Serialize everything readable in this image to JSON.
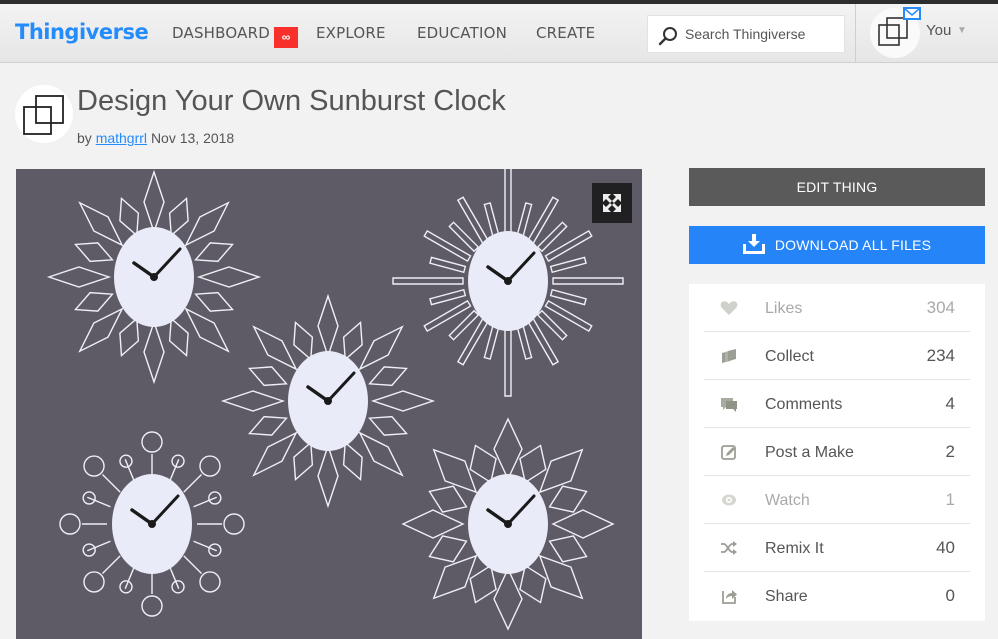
{
  "header": {
    "logo": "Thingiverse",
    "nav": [
      {
        "label": "DASHBOARD",
        "badge": "∞"
      },
      {
        "label": "EXPLORE"
      },
      {
        "label": "EDUCATION"
      },
      {
        "label": "CREATE"
      }
    ],
    "search": {
      "placeholder": "Search Thingiverse",
      "value": ""
    },
    "user": {
      "name": "You",
      "caret": "▼",
      "has_mail": true
    }
  },
  "thing": {
    "title": "Design Your Own Sunburst Clock",
    "by_prefix": "by",
    "author": "mathgrrl",
    "date": "Nov 13, 2018",
    "image_alt": "Five white sunburst wall clocks on a gray background"
  },
  "actions": {
    "edit_label": "EDIT THING",
    "download_label": "DOWNLOAD ALL FILES"
  },
  "stats": [
    {
      "icon": "heart-icon",
      "label": "Likes",
      "count": "304",
      "muted": true
    },
    {
      "icon": "collect-icon",
      "label": "Collect",
      "count": "234",
      "muted": false
    },
    {
      "icon": "comments-icon",
      "label": "Comments",
      "count": "4",
      "muted": false
    },
    {
      "icon": "post-make-icon",
      "label": "Post a Make",
      "count": "2",
      "muted": false
    },
    {
      "icon": "eye-icon",
      "label": "Watch",
      "count": "1",
      "muted": true
    },
    {
      "icon": "shuffle-icon",
      "label": "Remix It",
      "count": "40",
      "muted": false
    },
    {
      "icon": "share-icon",
      "label": "Share",
      "count": "0",
      "muted": false
    }
  ],
  "colors": {
    "brand_blue": "#248bfb",
    "download_blue": "#2585f8",
    "badge_red": "#f8302c",
    "edit_gray": "#5a5a5a",
    "icon_gray": "#a8aca0"
  }
}
